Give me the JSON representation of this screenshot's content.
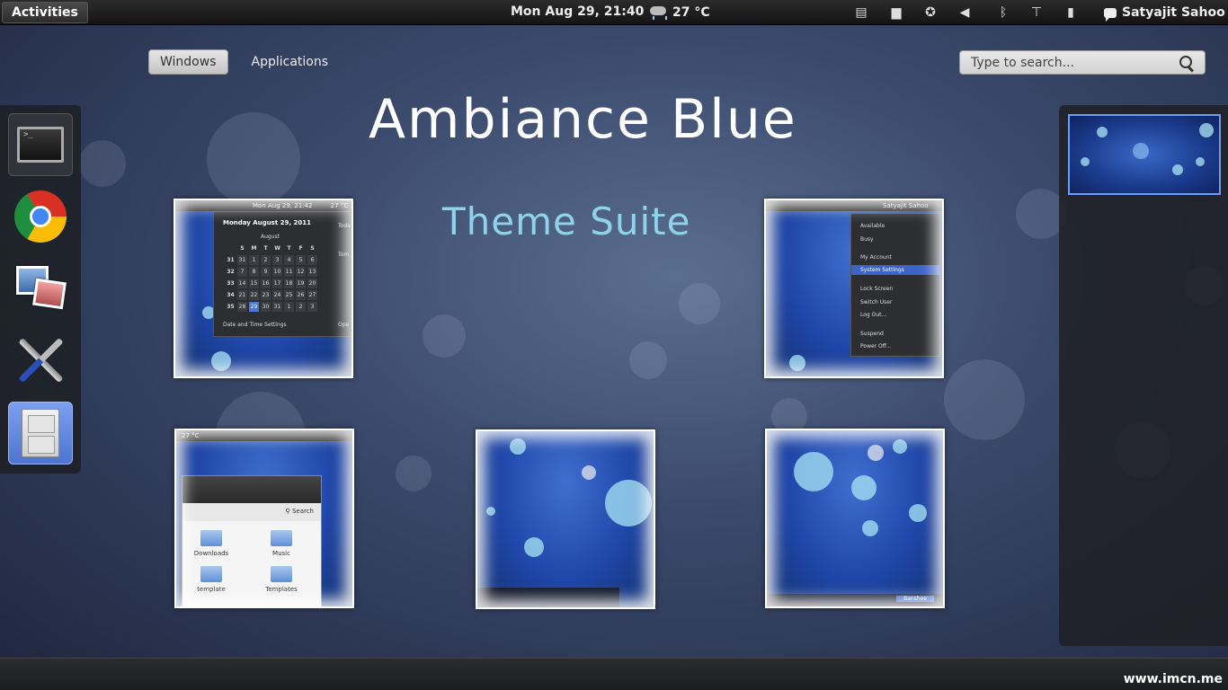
{
  "topbar": {
    "activities_label": "Activities",
    "clock": "Mon Aug 29, 21:40",
    "weather_temp": "27 °C",
    "user_name": "Satyajit Sahoo",
    "tray_icons": [
      "clipboard-icon",
      "folder-icon",
      "accessibility-icon",
      "volume-icon",
      "bluetooth-icon",
      "network-icon",
      "battery-icon"
    ]
  },
  "view_switch": {
    "windows_label": "Windows",
    "applications_label": "Applications",
    "active": "Windows"
  },
  "search": {
    "placeholder": "Type to search..."
  },
  "overlay": {
    "title": "Ambiance Blue",
    "subtitle": "Theme Suite"
  },
  "dash": {
    "items": [
      {
        "name": "terminal",
        "icon": "terminal-icon",
        "state": "running"
      },
      {
        "name": "chrome",
        "icon": "chrome-icon",
        "state": "normal"
      },
      {
        "name": "image-viewer",
        "icon": "photos-icon",
        "state": "normal"
      },
      {
        "name": "system-tools",
        "icon": "tools-icon",
        "state": "normal"
      },
      {
        "name": "file-manager",
        "icon": "file-cabinet-icon",
        "state": "active"
      }
    ]
  },
  "thumbnails": {
    "calendar": {
      "topbar_text": "Mon Aug 29, 21:42",
      "topbar_temp": "27 °C",
      "date_title": "Monday August 29, 2011",
      "month": "August",
      "side_today": "Toda",
      "side_tomorrow": "Tom",
      "side_open": "Ope",
      "weekdays": [
        "",
        "S",
        "M",
        "T",
        "W",
        "T",
        "F",
        "S"
      ],
      "rows": [
        [
          "31",
          "31",
          "1",
          "2",
          "3",
          "4",
          "5",
          "6"
        ],
        [
          "32",
          "7",
          "8",
          "9",
          "10",
          "11",
          "12",
          "13"
        ],
        [
          "33",
          "14",
          "15",
          "16",
          "17",
          "18",
          "19",
          "20"
        ],
        [
          "34",
          "21",
          "22",
          "23",
          "24",
          "25",
          "26",
          "27"
        ],
        [
          "35",
          "28",
          "29",
          "30",
          "31",
          "1",
          "2",
          "3"
        ]
      ],
      "today": "29",
      "settings_label": "Date and Time Settings"
    },
    "user_menu": {
      "user_name": "Satyajit Sahoo",
      "items": [
        "Available",
        "Busy",
        "My Account",
        "System Settings",
        "Lock Screen",
        "Switch User",
        "Log Out...",
        "Suspend",
        "Power Off..."
      ],
      "selected": "System Settings"
    },
    "files": {
      "topbar_temp": "27 °C",
      "search_label": "Search",
      "folders": [
        "Downloads",
        "Music",
        "template",
        "Templates"
      ]
    },
    "banshee_label": "Banshee"
  },
  "watermark": "www.imcn.me"
}
